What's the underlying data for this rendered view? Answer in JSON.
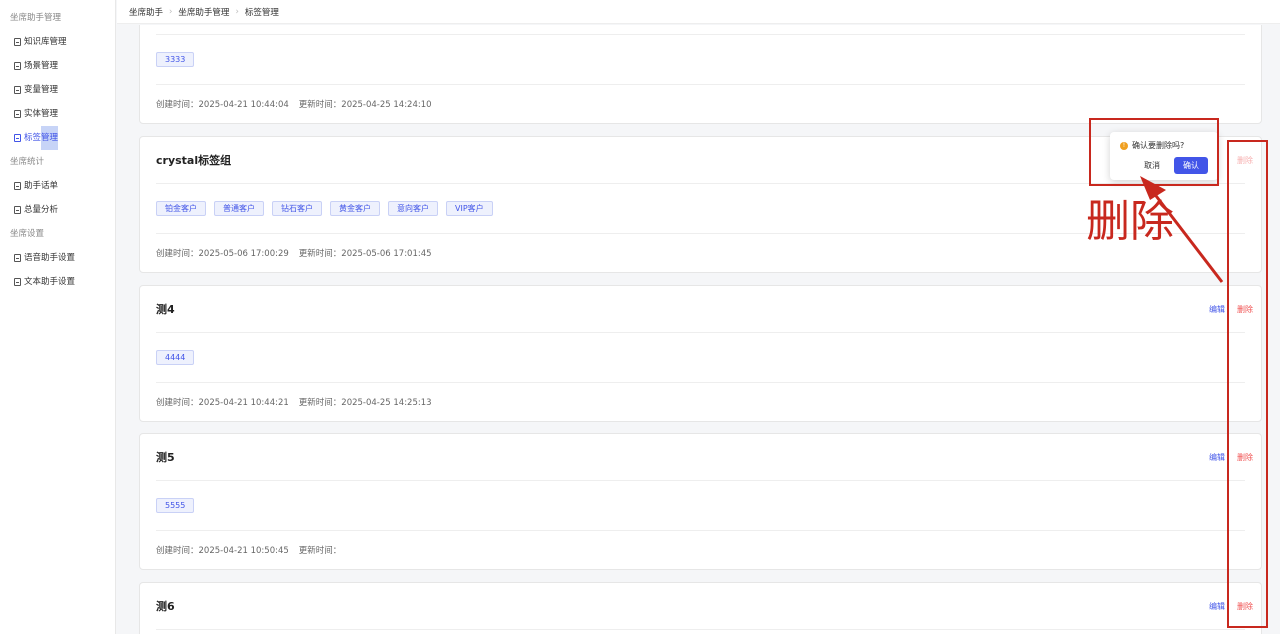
{
  "sidebar": {
    "group1": "坐席助手管理",
    "items1": [
      "知识库管理",
      "场景管理",
      "变量管理",
      "实体管理"
    ],
    "active_prefix": "标签",
    "active_suffix": "管理",
    "group2": "坐席统计",
    "items2": [
      "助手话单",
      "总量分析"
    ],
    "group3": "坐席设置",
    "items3": [
      "语音助手设置",
      "文本助手设置"
    ]
  },
  "breadcrumb": [
    "坐席助手",
    "坐席助手管理",
    "标签管理"
  ],
  "cards": [
    {
      "title": "",
      "tags": [
        "3333"
      ],
      "created": "创建时间：2025-04-21 10:44:04",
      "updated": "更新时间：2025-04-25 14:24:10"
    },
    {
      "title": "crystal标签组",
      "tags": [
        "铂金客户",
        "普通客户",
        "钻石客户",
        "黄金客户",
        "意向客户",
        "VIP客户"
      ],
      "created": "创建时间：2025-05-06 17:00:29",
      "updated": "更新时间：2025-05-06 17:01:45"
    },
    {
      "title": "测4",
      "tags": [
        "4444"
      ],
      "created": "创建时间：2025-04-21 10:44:21",
      "updated": "更新时间：2025-04-25 14:25:13"
    },
    {
      "title": "测5",
      "tags": [
        "5555"
      ],
      "created": "创建时间：2025-04-21 10:50:45",
      "updated": "更新时间："
    },
    {
      "title": "测6",
      "tags": [],
      "created": "",
      "updated": ""
    }
  ],
  "actions": {
    "edit": "编辑",
    "delete": "删除"
  },
  "popconfirm": {
    "message": "确认要删除吗?",
    "cancel": "取消",
    "ok": "确认",
    "icon": "warning-icon"
  },
  "annotation": {
    "label": "删除",
    "color": "#c8281e"
  },
  "colors": {
    "accent": "#4255e8",
    "danger": "#f05050"
  }
}
